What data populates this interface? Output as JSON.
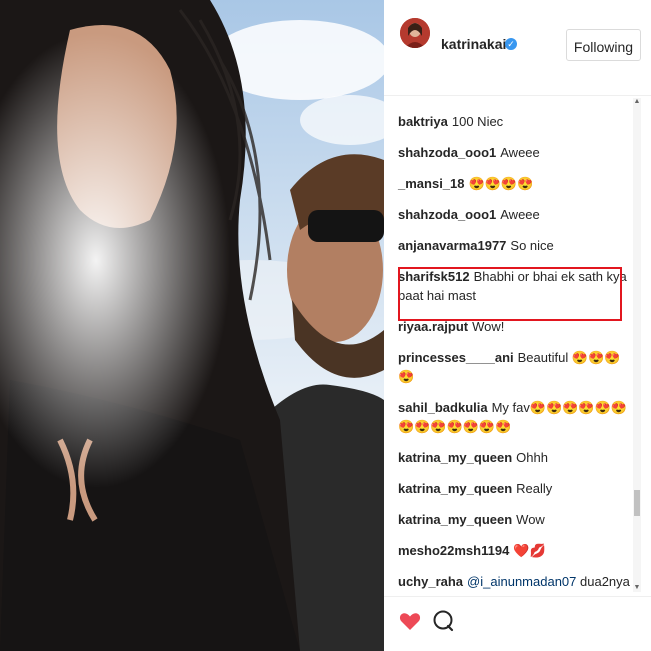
{
  "header": {
    "username": "katrinakaif",
    "follow_label": "Following"
  },
  "comments": [
    {
      "user": "baktriya",
      "text": "100 Niec"
    },
    {
      "user": "shahzoda_ooo1",
      "text": "Aweee"
    },
    {
      "user": "_mansi_18",
      "text": "😍😍😍😍"
    },
    {
      "user": "shahzoda_ooo1",
      "text": "Aweee"
    },
    {
      "user": "anjanavarma1977",
      "text": "So nice"
    },
    {
      "user": "sharifsk512",
      "text": "Bhabhi or bhai ek sath kya baat hai mast"
    },
    {
      "user": "riyaa.rajput",
      "text": "Wow!"
    },
    {
      "user": "princesses____ani",
      "text": "Beautiful 😍😍😍😍"
    },
    {
      "user": "sahil_badkulia",
      "text": "My fav😍😍😍😍😍😍😍😍😍😍😍😍😍"
    },
    {
      "user": "katrina_my_queen",
      "text": "Ohhh"
    },
    {
      "user": "katrina_my_queen",
      "text": "Really"
    },
    {
      "user": "katrina_my_queen",
      "text": "Wow"
    },
    {
      "user": "mesho22msh1194",
      "text": "❤️💋"
    },
    {
      "user": "uchy_raha",
      "mention": "@i_ainunmadan07",
      "text": "dua2nya"
    }
  ],
  "icons": {
    "like": "heart-icon",
    "comment": "comment-icon",
    "verified": "verified-badge-icon"
  },
  "colors": {
    "heart": "#ed4956",
    "highlight_box": "#e2161f",
    "verified": "#3897f0"
  }
}
